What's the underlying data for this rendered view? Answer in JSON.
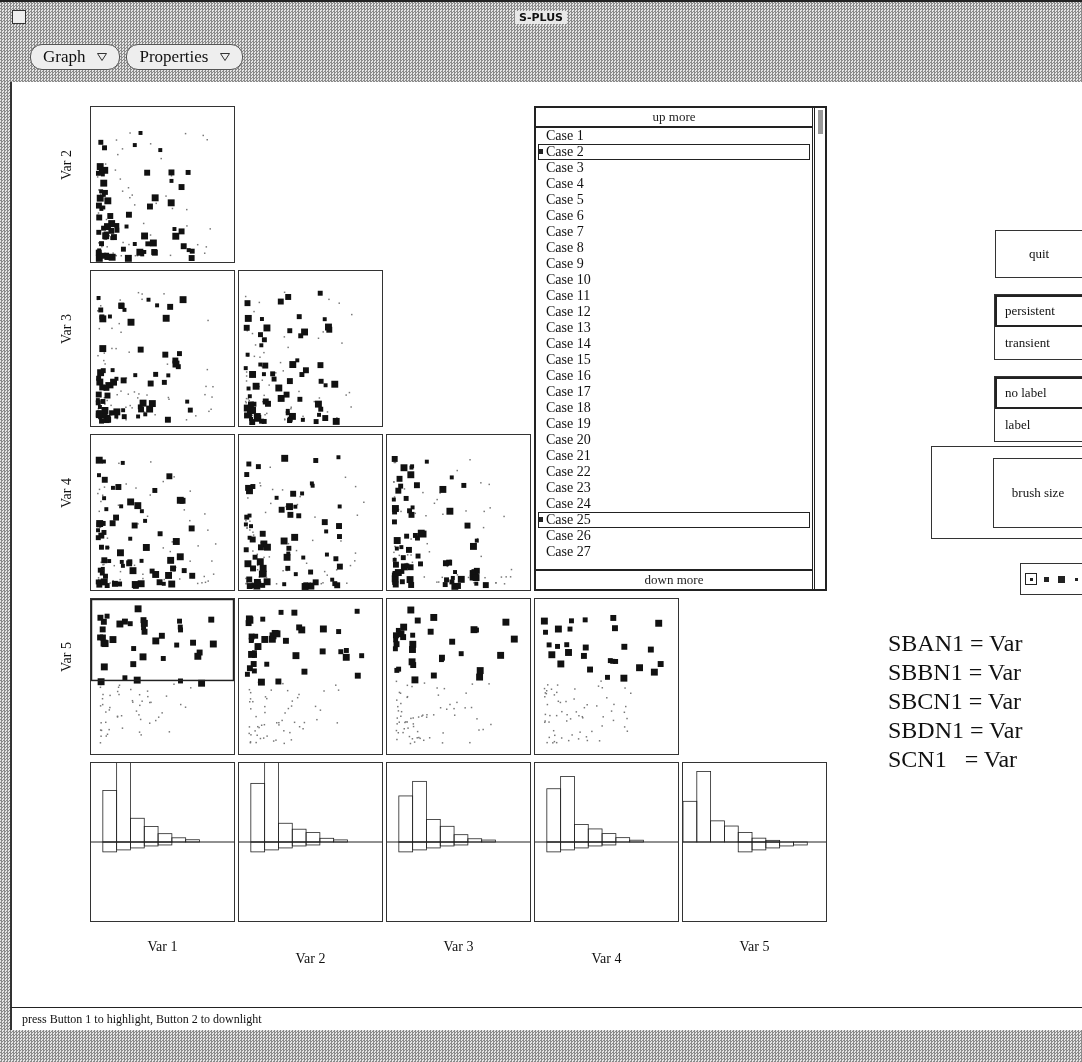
{
  "window": {
    "title": "S-PLUS"
  },
  "menus": [
    {
      "label": "Graph"
    },
    {
      "label": "Properties"
    }
  ],
  "matrix": {
    "rows": [
      {
        "label": "Var 2",
        "brushed": false
      },
      {
        "label": "Var 3",
        "brushed": false
      },
      {
        "label": "Var 4",
        "brushed": false
      },
      {
        "label": "Var 5",
        "brushed": true
      }
    ],
    "columns": [
      "Var 1",
      "Var 2",
      "Var 3",
      "Var 4",
      "Var 5"
    ]
  },
  "case_list": {
    "up": "up more",
    "down": "down more",
    "items": [
      {
        "label": "Case 1",
        "selected": false
      },
      {
        "label": "Case 2",
        "selected": true
      },
      {
        "label": "Case 3",
        "selected": false
      },
      {
        "label": "Case 4",
        "selected": false
      },
      {
        "label": "Case 5",
        "selected": false
      },
      {
        "label": "Case 6",
        "selected": false
      },
      {
        "label": "Case 7",
        "selected": false
      },
      {
        "label": "Case 8",
        "selected": false
      },
      {
        "label": "Case 9",
        "selected": false
      },
      {
        "label": "Case 10",
        "selected": false
      },
      {
        "label": "Case 11",
        "selected": false
      },
      {
        "label": "Case 12",
        "selected": false
      },
      {
        "label": "Case 13",
        "selected": false
      },
      {
        "label": "Case 14",
        "selected": false
      },
      {
        "label": "Case 15",
        "selected": false
      },
      {
        "label": "Case 16",
        "selected": false
      },
      {
        "label": "Case 17",
        "selected": false
      },
      {
        "label": "Case 18",
        "selected": false
      },
      {
        "label": "Case 19",
        "selected": false
      },
      {
        "label": "Case 20",
        "selected": false
      },
      {
        "label": "Case 21",
        "selected": false
      },
      {
        "label": "Case 22",
        "selected": false
      },
      {
        "label": "Case 23",
        "selected": false
      },
      {
        "label": "Case 24",
        "selected": false
      },
      {
        "label": "Case 25",
        "selected": true
      },
      {
        "label": "Case 26",
        "selected": false
      },
      {
        "label": "Case 27",
        "selected": false
      }
    ]
  },
  "controls": {
    "quit": "quit",
    "mode": [
      {
        "label": "persistent",
        "selected": true
      },
      {
        "label": "transient",
        "selected": false
      }
    ],
    "labeling": [
      {
        "label": "no label",
        "selected": true
      },
      {
        "label": "label",
        "selected": false
      }
    ],
    "brush_size": "brush size",
    "brush_shapes": [
      {
        "kind": "dot",
        "selected": true
      },
      {
        "kind": "small_square",
        "selected": false
      },
      {
        "kind": "square",
        "selected": false
      },
      {
        "kind": "dot",
        "selected": false
      }
    ]
  },
  "equations": [
    "SBAN1 = Var",
    "SBBN1 = Var",
    "SBCN1 = Var",
    "SBDN1 = Var",
    "SCN1   = Var"
  ],
  "status_bar": "press Button 1 to highlight, Button 2 to downlight"
}
